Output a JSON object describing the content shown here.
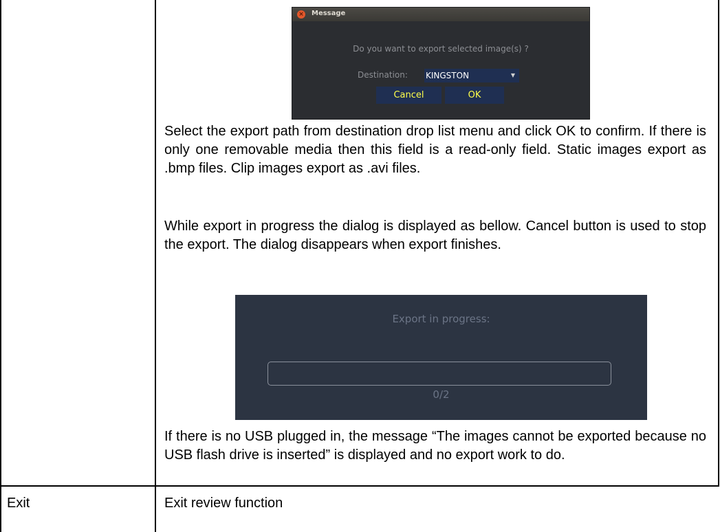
{
  "export_dialog": {
    "title": "Message",
    "question": "Do you want to export selected image(s) ?",
    "destination_label": "Destination:",
    "destination_value": "KINGSTON",
    "cancel_label": "Cancel",
    "ok_label": "OK"
  },
  "paragraphs": {
    "p1": "Select the export path from destination drop list menu and click OK to confirm. If there is only one removable media then this field is a read-only field. Static images export as .bmp files. Clip images export as .avi files.",
    "p2": "While export in progress the dialog is displayed as bellow. Cancel button is used to stop the export. The dialog disappears when export finishes.",
    "p3": "If there is no USB plugged in, the message “The images cannot be exported because no USB flash drive is inserted” is displayed and no export work to do."
  },
  "progress_dialog": {
    "label": "Export in progress:",
    "count": "0/2",
    "progress_fraction": 0
  },
  "table_row": {
    "name": "Exit",
    "description": "Exit review function"
  }
}
